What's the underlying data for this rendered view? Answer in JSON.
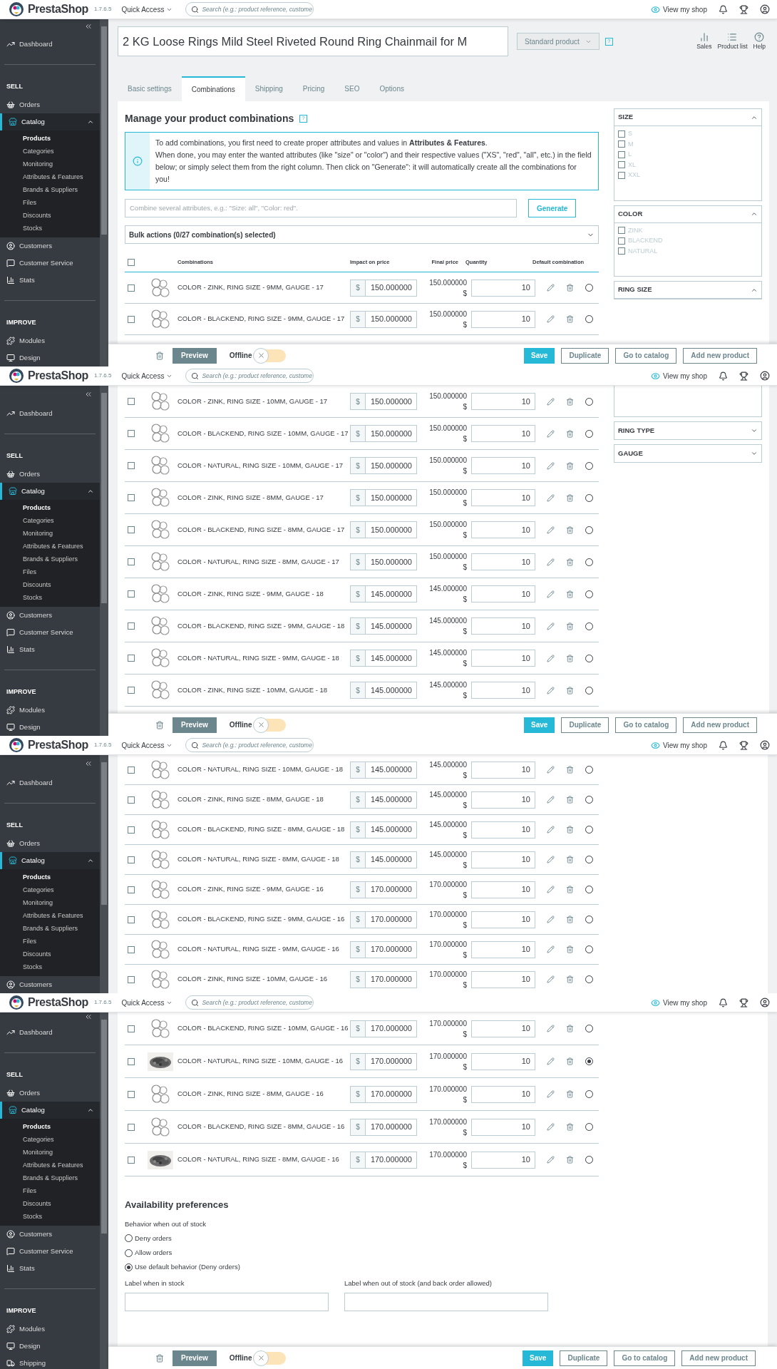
{
  "segments": [
    {
      "header": {
        "logo": "PrestaShop",
        "version": "1.7.6.5",
        "quick_access": "Quick Access",
        "search_placeholder": "Search (e.g.: product reference, custome",
        "view_shop": "View my shop"
      },
      "sidebar": {
        "items": [
          {
            "kind": "item",
            "label": "Dashboard",
            "selected": false
          },
          {
            "kind": "section",
            "label": "SELL"
          },
          {
            "kind": "item",
            "label": "Orders",
            "selected": false
          },
          {
            "kind": "item",
            "label": "Catalog",
            "selected": true,
            "expanded": true,
            "children": [
              {
                "label": "Products",
                "selected": true
              },
              {
                "label": "Categories",
                "selected": false
              },
              {
                "label": "Monitoring",
                "selected": false
              },
              {
                "label": "Attributes & Features",
                "selected": false
              },
              {
                "label": "Brands & Suppliers",
                "selected": false
              },
              {
                "label": "Files",
                "selected": false
              },
              {
                "label": "Discounts",
                "selected": false
              },
              {
                "label": "Stocks",
                "selected": false
              }
            ]
          },
          {
            "kind": "item",
            "label": "Customers",
            "selected": false
          },
          {
            "kind": "item",
            "label": "Customer Service",
            "selected": false
          },
          {
            "kind": "item",
            "label": "Stats",
            "selected": false
          },
          {
            "kind": "section",
            "label": "IMPROVE"
          },
          {
            "kind": "item",
            "label": "Modules",
            "selected": false
          },
          {
            "kind": "item",
            "label": "Design",
            "selected": false
          }
        ]
      },
      "title_bar": {
        "product_name": "2 KG Loose Rings Mild Steel Riveted Round Ring Chainmail for M",
        "product_type": "Standard product",
        "help_mark": "?",
        "tools": [
          "Sales",
          "Product list",
          "Help"
        ]
      },
      "tabs": [
        {
          "label": "Basic settings",
          "selected": false
        },
        {
          "label": "Combinations",
          "selected": true
        },
        {
          "label": "Shipping",
          "selected": false
        },
        {
          "label": "Pricing",
          "selected": false
        },
        {
          "label": "SEO",
          "selected": false
        },
        {
          "label": "Options",
          "selected": false
        }
      ],
      "combinations": {
        "heading": "Manage your product combinations",
        "help_mark": "?",
        "info": [
          "To add combinations, you first need to create proper attributes and values in **Attributes & Features**.",
          "When done, you may enter the wanted attributes (like \"size\" or \"color\") and their respective values (\"XS\", \"red\", \"all\", etc.) in the field below; or simply select them from the right column. Then click on \"Generate\": it will automatically create all the combinations for you!"
        ],
        "combine_placeholder": "Combine several attributes, e.g.: \"Size: all\", \"Color: red\".",
        "generate": "Generate",
        "bulk_actions": "Bulk actions (0/27 combination(s) selected)"
      },
      "table": {
        "select_all": {
          "checked": false
        },
        "columns": [
          "Combinations",
          "Impact on price",
          "Final price",
          "Quantity",
          "Default combination"
        ],
        "rows": [
          {
            "checked": false,
            "kind": "rings",
            "name": "COLOR - ZINK, RING SIZE - 9MM, GAUGE - 17",
            "currency": "$",
            "impact": "150.000000",
            "final_price": "150.000000",
            "final_currency": "$",
            "quantity": "10",
            "selected": false
          },
          {
            "checked": false,
            "kind": "rings",
            "name": "COLOR - BLACKEND, RING SIZE - 9MM, GAUGE - 17",
            "currency": "$",
            "impact": "150.000000",
            "final_price": "150.000000",
            "final_currency": "$",
            "quantity": "10",
            "selected": false
          }
        ]
      },
      "filters": [
        {
          "title": "SIZE",
          "expanded": true,
          "options": [
            {
              "label": "S",
              "checked": false
            },
            {
              "label": "M",
              "checked": false
            },
            {
              "label": "L",
              "checked": false
            },
            {
              "label": "XL",
              "checked": false
            },
            {
              "label": "XXL",
              "checked": false
            }
          ]
        },
        {
          "title": "COLOR",
          "expanded": true,
          "options": [
            {
              "label": "ZINK",
              "checked": false
            },
            {
              "label": "BLACKEND",
              "checked": false
            },
            {
              "label": "NATURAL",
              "checked": false
            }
          ]
        },
        {
          "title": "RING SIZE",
          "expanded": true
        }
      ],
      "footer": {
        "preview": "Preview",
        "status": "Offline",
        "online": false,
        "buttons": [
          "Save",
          "Duplicate",
          "Go to catalog",
          "Add new product"
        ]
      }
    },
    {
      "header": {
        "logo": "PrestaShop",
        "version": "1.7.6.5",
        "quick_access": "Quick Access",
        "search_placeholder": "Search (e.g.: product reference, custome",
        "view_shop": "View my shop"
      },
      "sidebar": {
        "items": [
          {
            "kind": "item",
            "label": "Dashboard",
            "selected": false
          },
          {
            "kind": "section",
            "label": "SELL"
          },
          {
            "kind": "item",
            "label": "Orders",
            "selected": false
          },
          {
            "kind": "item",
            "label": "Catalog",
            "selected": true,
            "expanded": true,
            "children": [
              {
                "label": "Products",
                "selected": true
              },
              {
                "label": "Categories",
                "selected": false
              },
              {
                "label": "Monitoring",
                "selected": false
              },
              {
                "label": "Attributes & Features",
                "selected": false
              },
              {
                "label": "Brands & Suppliers",
                "selected": false
              },
              {
                "label": "Files",
                "selected": false
              },
              {
                "label": "Discounts",
                "selected": false
              },
              {
                "label": "Stocks",
                "selected": false
              }
            ]
          },
          {
            "kind": "item",
            "label": "Customers",
            "selected": false
          },
          {
            "kind": "item",
            "label": "Customer Service",
            "selected": false
          },
          {
            "kind": "item",
            "label": "Stats",
            "selected": false
          },
          {
            "kind": "section",
            "label": "IMPROVE"
          },
          {
            "kind": "item",
            "label": "Modules",
            "selected": false
          },
          {
            "kind": "item",
            "label": "Design",
            "selected": false
          }
        ]
      },
      "table": {
        "rows": [
          {
            "checked": false,
            "kind": "rings",
            "name": "COLOR - ZINK, RING SIZE - 10MM, GAUGE - 17",
            "currency": "$",
            "impact": "150.000000",
            "final_price": "150.000000",
            "final_currency": "$",
            "quantity": "10",
            "selected": false
          },
          {
            "checked": false,
            "kind": "rings",
            "name": "COLOR - BLACKEND, RING SIZE - 10MM, GAUGE - 17",
            "currency": "$",
            "impact": "150.000000",
            "final_price": "150.000000",
            "final_currency": "$",
            "quantity": "10",
            "selected": false
          },
          {
            "checked": false,
            "kind": "rings",
            "name": "COLOR - NATURAL, RING SIZE - 10MM, GAUGE - 17",
            "currency": "$",
            "impact": "150.000000",
            "final_price": "150.000000",
            "final_currency": "$",
            "quantity": "10",
            "selected": false
          },
          {
            "checked": false,
            "kind": "rings",
            "name": "COLOR - ZINK, RING SIZE - 8MM, GAUGE - 17",
            "currency": "$",
            "impact": "150.000000",
            "final_price": "150.000000",
            "final_currency": "$",
            "quantity": "10",
            "selected": false
          },
          {
            "checked": false,
            "kind": "rings",
            "name": "COLOR - BLACKEND, RING SIZE - 8MM, GAUGE - 17",
            "currency": "$",
            "impact": "150.000000",
            "final_price": "150.000000",
            "final_currency": "$",
            "quantity": "10",
            "selected": false
          },
          {
            "checked": false,
            "kind": "rings",
            "name": "COLOR - NATURAL, RING SIZE - 8MM, GAUGE - 17",
            "currency": "$",
            "impact": "150.000000",
            "final_price": "150.000000",
            "final_currency": "$",
            "quantity": "10",
            "selected": false
          },
          {
            "checked": false,
            "kind": "rings",
            "name": "COLOR - ZINK, RING SIZE - 9MM, GAUGE - 18",
            "currency": "$",
            "impact": "145.000000",
            "final_price": "145.000000",
            "final_currency": "$",
            "quantity": "10",
            "selected": false
          },
          {
            "checked": false,
            "kind": "rings",
            "name": "COLOR - BLACKEND, RING SIZE - 9MM, GAUGE - 18",
            "currency": "$",
            "impact": "145.000000",
            "final_price": "145.000000",
            "final_currency": "$",
            "quantity": "10",
            "selected": false
          },
          {
            "checked": false,
            "kind": "rings",
            "name": "COLOR - NATURAL, RING SIZE - 9MM, GAUGE - 18",
            "currency": "$",
            "impact": "145.000000",
            "final_price": "145.000000",
            "final_currency": "$",
            "quantity": "10",
            "selected": false
          },
          {
            "checked": false,
            "kind": "rings",
            "name": "COLOR - ZINK, RING SIZE - 10MM, GAUGE - 18",
            "currency": "$",
            "impact": "145.000000",
            "final_price": "145.000000",
            "final_currency": "$",
            "quantity": "10",
            "selected": false
          }
        ]
      },
      "filters": [
        {
          "title": "RING TYPE",
          "expanded": false
        },
        {
          "title": "GAUGE",
          "expanded": false
        }
      ],
      "footer": {
        "preview": "Preview",
        "status": "Offline",
        "online": false,
        "buttons": [
          "Save",
          "Duplicate",
          "Go to catalog",
          "Add new product"
        ]
      }
    },
    {
      "header": {
        "logo": "PrestaShop",
        "version": "1.7.6.5",
        "quick_access": "Quick Access",
        "search_placeholder": "Search (e.g.: product reference, custome",
        "view_shop": "View my shop"
      },
      "sidebar": {
        "items": [
          {
            "kind": "item",
            "label": "Dashboard",
            "selected": false
          },
          {
            "kind": "section",
            "label": "SELL"
          },
          {
            "kind": "item",
            "label": "Orders",
            "selected": false
          },
          {
            "kind": "item",
            "label": "Catalog",
            "selected": true,
            "expanded": true,
            "children": [
              {
                "label": "Products",
                "selected": true
              },
              {
                "label": "Categories",
                "selected": false
              },
              {
                "label": "Monitoring",
                "selected": false
              },
              {
                "label": "Attributes & Features",
                "selected": false
              },
              {
                "label": "Brands & Suppliers",
                "selected": false
              },
              {
                "label": "Files",
                "selected": false
              },
              {
                "label": "Discounts",
                "selected": false
              },
              {
                "label": "Stocks",
                "selected": false
              }
            ]
          },
          {
            "kind": "item",
            "label": "Customers",
            "selected": false
          }
        ]
      },
      "table": {
        "rows": [
          {
            "checked": false,
            "kind": "rings",
            "name": "COLOR - NATURAL, RING SIZE - 10MM, GAUGE - 18",
            "currency": "$",
            "impact": "145.000000",
            "final_price": "145.000000",
            "final_currency": "$",
            "quantity": "10",
            "selected": false
          },
          {
            "checked": false,
            "kind": "rings",
            "name": "COLOR - ZINK, RING SIZE - 8MM, GAUGE - 18",
            "currency": "$",
            "impact": "145.000000",
            "final_price": "145.000000",
            "final_currency": "$",
            "quantity": "10",
            "selected": false
          },
          {
            "checked": false,
            "kind": "rings",
            "name": "COLOR - BLACKEND, RING SIZE - 8MM, GAUGE - 18",
            "currency": "$",
            "impact": "145.000000",
            "final_price": "145.000000",
            "final_currency": "$",
            "quantity": "10",
            "selected": false
          },
          {
            "checked": false,
            "kind": "rings",
            "name": "COLOR - NATURAL, RING SIZE - 8MM, GAUGE - 18",
            "currency": "$",
            "impact": "145.000000",
            "final_price": "145.000000",
            "final_currency": "$",
            "quantity": "10",
            "selected": false
          },
          {
            "checked": false,
            "kind": "rings",
            "name": "COLOR - ZINK, RING SIZE - 9MM, GAUGE - 16",
            "currency": "$",
            "impact": "170.000000",
            "final_price": "170.000000",
            "final_currency": "$",
            "quantity": "10",
            "selected": false
          },
          {
            "checked": false,
            "kind": "rings",
            "name": "COLOR - BLACKEND, RING SIZE - 9MM, GAUGE - 16",
            "currency": "$",
            "impact": "170.000000",
            "final_price": "170.000000",
            "final_currency": "$",
            "quantity": "10",
            "selected": false
          },
          {
            "checked": false,
            "kind": "rings",
            "name": "COLOR - NATURAL, RING SIZE - 9MM, GAUGE - 16",
            "currency": "$",
            "impact": "170.000000",
            "final_price": "170.000000",
            "final_currency": "$",
            "quantity": "10",
            "selected": false
          },
          {
            "checked": false,
            "kind": "rings",
            "name": "COLOR - ZINK, RING SIZE - 10MM, GAUGE - 16",
            "currency": "$",
            "impact": "170.000000",
            "final_price": "170.000000",
            "final_currency": "$",
            "quantity": "10",
            "selected": false
          }
        ]
      }
    },
    {
      "header": {
        "logo": "PrestaShop",
        "version": "1.7.6.5",
        "quick_access": "Quick Access",
        "search_placeholder": "Search (e.g.: product reference, custome",
        "view_shop": "View my shop"
      },
      "sidebar": {
        "items": [
          {
            "kind": "item",
            "label": "Dashboard",
            "selected": false
          },
          {
            "kind": "section",
            "label": "SELL"
          },
          {
            "kind": "item",
            "label": "Orders",
            "selected": false
          },
          {
            "kind": "item",
            "label": "Catalog",
            "selected": true,
            "expanded": true,
            "children": [
              {
                "label": "Products",
                "selected": true
              },
              {
                "label": "Categories",
                "selected": false
              },
              {
                "label": "Monitoring",
                "selected": false
              },
              {
                "label": "Attributes & Features",
                "selected": false
              },
              {
                "label": "Brands & Suppliers",
                "selected": false
              },
              {
                "label": "Files",
                "selected": false
              },
              {
                "label": "Discounts",
                "selected": false
              },
              {
                "label": "Stocks",
                "selected": false
              }
            ]
          },
          {
            "kind": "item",
            "label": "Customers",
            "selected": false
          },
          {
            "kind": "item",
            "label": "Customer Service",
            "selected": false
          },
          {
            "kind": "item",
            "label": "Stats",
            "selected": false
          },
          {
            "kind": "section",
            "label": "IMPROVE"
          },
          {
            "kind": "item",
            "label": "Modules",
            "selected": false
          },
          {
            "kind": "item",
            "label": "Design",
            "selected": false
          },
          {
            "kind": "item",
            "label": "Shipping",
            "selected": false
          }
        ]
      },
      "table": {
        "rows": [
          {
            "checked": false,
            "kind": "rings",
            "name": "COLOR - BLACKEND, RING SIZE - 10MM, GAUGE - 16",
            "currency": "$",
            "impact": "170.000000",
            "final_price": "170.000000",
            "final_currency": "$",
            "quantity": "10",
            "selected": false
          },
          {
            "checked": false,
            "kind": "pile",
            "name": "COLOR - NATURAL, RING SIZE - 10MM, GAUGE - 16",
            "currency": "$",
            "impact": "170.000000",
            "final_price": "170.000000",
            "final_currency": "$",
            "quantity": "10",
            "selected": true
          },
          {
            "checked": false,
            "kind": "rings",
            "name": "COLOR - ZINK, RING SIZE - 8MM, GAUGE - 16",
            "currency": "$",
            "impact": "170.000000",
            "final_price": "170.000000",
            "final_currency": "$",
            "quantity": "10",
            "selected": false
          },
          {
            "checked": false,
            "kind": "rings",
            "name": "COLOR - BLACKEND, RING SIZE - 8MM, GAUGE - 16",
            "currency": "$",
            "impact": "170.000000",
            "final_price": "170.000000",
            "final_currency": "$",
            "quantity": "10",
            "selected": false
          },
          {
            "checked": false,
            "kind": "pile",
            "name": "COLOR - NATURAL, RING SIZE - 8MM, GAUGE - 16",
            "currency": "$",
            "impact": "170.000000",
            "final_price": "170.000000",
            "final_currency": "$",
            "quantity": "10",
            "selected": false
          }
        ]
      },
      "availability": {
        "heading": "Availability preferences",
        "behavior_label": "Behavior when out of stock",
        "options": [
          {
            "label": "Deny orders",
            "selected": false
          },
          {
            "label": "Allow orders",
            "selected": false
          },
          {
            "label": "Use default behavior (Deny orders)",
            "selected": true
          }
        ],
        "fields": [
          {
            "label": "Label when in stock"
          },
          {
            "label": "Label when out of stock (and back order allowed)"
          }
        ]
      },
      "footer": {
        "preview": "Preview",
        "status": "Offline",
        "online": false,
        "buttons": [
          "Save",
          "Duplicate",
          "Go to catalog",
          "Add new product"
        ]
      }
    }
  ]
}
